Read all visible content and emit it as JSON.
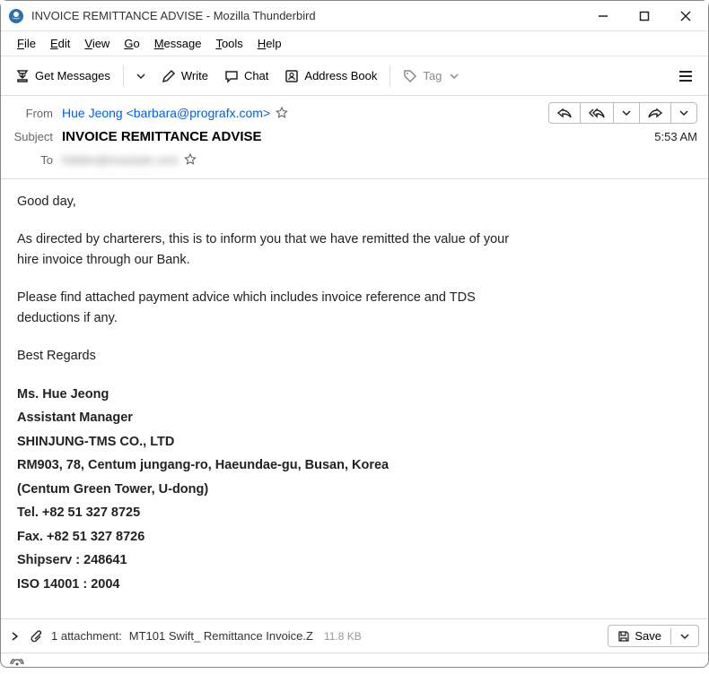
{
  "window": {
    "title": "INVOICE REMITTANCE ADVISE - Mozilla Thunderbird"
  },
  "menubar": {
    "file": "File",
    "edit": "Edit",
    "view": "View",
    "go": "Go",
    "message": "Message",
    "tools": "Tools",
    "help": "Help"
  },
  "toolbar": {
    "get_messages": "Get Messages",
    "write": "Write",
    "chat": "Chat",
    "address_book": "Address Book",
    "tag": "Tag"
  },
  "headers": {
    "from_label": "From",
    "from_value": "Hue Jeong <barbara@prografx.com>",
    "subject_label": "Subject",
    "subject_value": "INVOICE REMITTANCE ADVISE",
    "to_label": "To",
    "to_value_hidden": "hidden@example.com",
    "time": "5:53 AM"
  },
  "body": {
    "greeting": "Good day,",
    "p1": "As directed by charterers, this is to inform you that we have remitted the value of your hire invoice through our Bank.",
    "p2": "Please find attached payment advice which includes invoice reference and TDS deductions if any.",
    "closing": "Best  Regards",
    "sig_name": "Ms. Hue Jeong",
    "sig_title": "Assistant Manager",
    "sig_company": "SHINJUNG-TMS CO., LTD",
    "sig_addr1": "RM903, 78, Centum jungang-ro, Haeundae-gu, Busan, Korea",
    "sig_addr2": "(Centum Green Tower, U-dong)",
    "sig_tel": "Tel. +82 51 327 8725",
    "sig_fax": "Fax. +82 51 327 8726",
    "sig_ship": "Shipserv : 248641",
    "sig_iso": "ISO 14001 : 2004"
  },
  "attachment": {
    "count_text": "1 attachment:",
    "filename": "MT101 Swift_ Remittance Invoice.Z",
    "size": "11.8 KB",
    "save_label": "Save"
  }
}
